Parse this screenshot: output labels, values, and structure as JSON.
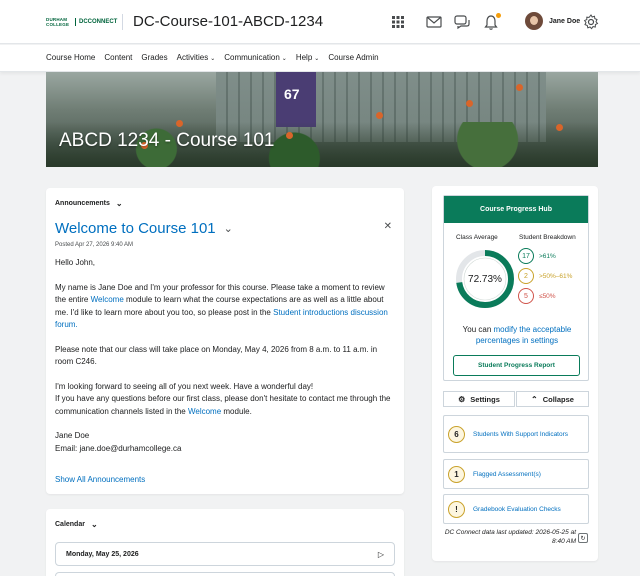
{
  "header": {
    "logo_left": "DURHAM COLLEGE",
    "logo_right": "DCCONNECT",
    "org_name": "DC-Course-101-ABCD-1234",
    "user_name": "Jane Doe",
    "icons": [
      "apps-grid-icon",
      "mail-icon",
      "chat-icon",
      "bell-icon",
      "gear-icon"
    ]
  },
  "nav": {
    "items": [
      {
        "label": "Course Home",
        "dropdown": false
      },
      {
        "label": "Content",
        "dropdown": false
      },
      {
        "label": "Grades",
        "dropdown": false
      },
      {
        "label": "Activities",
        "dropdown": true
      },
      {
        "label": "Communication",
        "dropdown": true
      },
      {
        "label": "Help",
        "dropdown": true
      },
      {
        "label": "Course Admin",
        "dropdown": false
      }
    ]
  },
  "banner": {
    "title": "ABCD 1234 - Course 101"
  },
  "announcements": {
    "widget_title": "Announcements",
    "heading": "Welcome to Course 101",
    "posted": "Posted Apr 27, 2026 9:40 AM",
    "greeting": "Hello John,",
    "p1_a": "My name is Jane Doe and I'm your professor for this course. Please take a moment to review the entire ",
    "p1_link1": "Welcome",
    "p1_b": " module to learn what the course expectations are as well as a little about me. I'd like to learn more about you too, so please post in the ",
    "p1_link2": "Student introductions discussion forum.",
    "p2": "Please note that our class will take place on Monday, May 4, 2026 from 8 a.m. to 11 a.m. in room C246.",
    "p3_line1": "I'm looking forward to seeing all of you next week. Have a wonderful day!",
    "p3_a": "If you have any questions before our first class, please don't hesitate to contact me through the communication channels listed in the ",
    "p3_link": "Welcome",
    "p3_b": " module.",
    "sig_name": "Jane Doe",
    "sig_email": "Email: jane.doe@durhamcollege.ca",
    "show_all": "Show All Announcements"
  },
  "calendar": {
    "widget_title": "Calendar",
    "day": "Monday, May 25, 2026"
  },
  "progress_hub": {
    "title": "Course Progress Hub",
    "class_average_label": "Class Average",
    "breakdown_label": "Student Breakdown",
    "class_average": "72.73%",
    "class_average_value": 72.73,
    "breakdown": [
      {
        "count": "17",
        "range": ">61%",
        "color": "#0a7b5a"
      },
      {
        "count": "2",
        "range": ">50%–61%",
        "color": "#c9a22b"
      },
      {
        "count": "5",
        "range": "≤50%",
        "color": "#d0544b"
      }
    ],
    "text_prefix": "You can ",
    "text_link": "modify the acceptable percentages in settings",
    "report_button": "Student Progress Report",
    "settings_label": "Settings",
    "collapse_label": "Collapse",
    "alerts": [
      {
        "count": "6",
        "label": "Students With Support Indicators"
      },
      {
        "count": "1",
        "label": "Flagged Assessment(s)"
      },
      {
        "count": "!",
        "label": "Gradebook Evaluation Checks"
      }
    ],
    "updated": "DC Connect data last updated: 2026-05-25 at 8:40 AM"
  },
  "colors": {
    "accent_green": "#0a7b5a",
    "link_blue": "#006fbf"
  }
}
